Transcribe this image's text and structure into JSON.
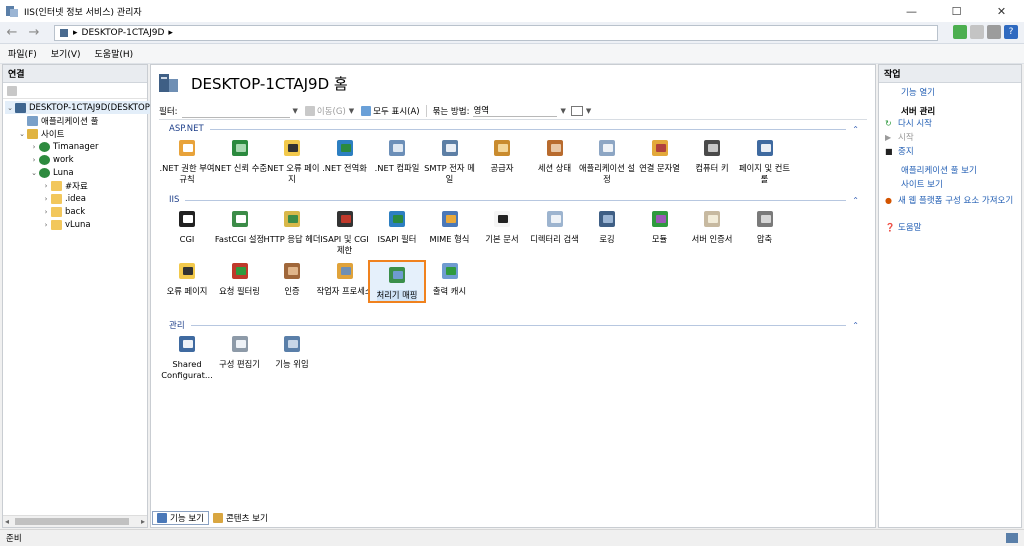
{
  "window": {
    "title": "IIS(인터넷 정보 서비스) 관리자",
    "minimize": "—",
    "maximize": "☐",
    "close": "✕"
  },
  "address": {
    "back": "←",
    "forward": "→",
    "segment": "DESKTOP-1CTAJ9D",
    "sep1": "▸",
    "sep2": "▸",
    "help_label": "?"
  },
  "menu": {
    "items": [
      "파일(F)",
      "보기(V)",
      "도움말(H)"
    ]
  },
  "connections": {
    "header": "연결",
    "tree": [
      {
        "label": "DESKTOP-1CTAJ9D(DESKTOP",
        "exp": "⌄",
        "icon": "server-icon"
      },
      {
        "label": "애플리케이션 풀",
        "exp": "",
        "icon": "app-pool-icon"
      },
      {
        "label": "사이트",
        "exp": "⌄",
        "icon": "sites-icon"
      },
      {
        "label": "Timanager",
        "exp": "›",
        "icon": "globe-icon"
      },
      {
        "label": "work",
        "exp": "›",
        "icon": "globe-icon"
      },
      {
        "label": "Luna",
        "exp": "⌄",
        "icon": "globe-icon"
      },
      {
        "label": "#자료",
        "exp": "›",
        "icon": "folder-icon"
      },
      {
        "label": ".idea",
        "exp": "›",
        "icon": "folder-icon"
      },
      {
        "label": "back",
        "exp": "›",
        "icon": "folder-icon"
      },
      {
        "label": "vLuna",
        "exp": "›",
        "icon": "folder-icon"
      }
    ]
  },
  "home": {
    "title": "DESKTOP-1CTAJ9D 홈",
    "filter_label": "필터:",
    "go_label": "이동(G)",
    "show_all_label": "모두 표시(A)",
    "group_by_label": "묶는 방법:",
    "group_by_value": "영역"
  },
  "groups": {
    "aspnet": "ASP.NET",
    "iis": "IIS",
    "management": "관리",
    "collapse": "⌃"
  },
  "features_aspnet": [
    {
      "label": ".NET 권한 부여 규칙",
      "icon": "authorization-rules-icon"
    },
    {
      "label": ".NET 신뢰 수준",
      "icon": "trust-levels-icon"
    },
    {
      "label": ".NET 오류 페이지",
      "icon": "net-error-pages-icon"
    },
    {
      "label": ".NET 전역화",
      "icon": "globalization-icon"
    },
    {
      "label": ".NET 컴파일",
      "icon": "compilation-icon"
    },
    {
      "label": "SMTP 전자 메일",
      "icon": "smtp-email-icon"
    },
    {
      "label": "공급자",
      "icon": "providers-icon"
    },
    {
      "label": "세션 상태",
      "icon": "session-state-icon"
    },
    {
      "label": "애플리케이션 설정",
      "icon": "app-settings-icon"
    },
    {
      "label": "연결 문자열",
      "icon": "connection-strings-icon"
    },
    {
      "label": "컴퓨터 키",
      "icon": "machine-key-icon"
    },
    {
      "label": "페이지 및 컨트롤",
      "icon": "pages-controls-icon"
    }
  ],
  "features_iis_row1": [
    {
      "label": "CGI",
      "icon": "cgi-icon"
    },
    {
      "label": "FastCGI 설정",
      "icon": "fastcgi-icon"
    },
    {
      "label": "HTTP 응답 헤더",
      "icon": "http-headers-icon"
    },
    {
      "label": "ISAPI 및 CGI 제한",
      "icon": "isapi-cgi-restrictions-icon"
    },
    {
      "label": "ISAPI 필터",
      "icon": "isapi-filters-icon"
    },
    {
      "label": "MIME 형식",
      "icon": "mime-types-icon"
    },
    {
      "label": "기본 문서",
      "icon": "default-document-icon"
    },
    {
      "label": "디렉터리 검색",
      "icon": "directory-browsing-icon"
    },
    {
      "label": "로깅",
      "icon": "logging-icon"
    },
    {
      "label": "모듈",
      "icon": "modules-icon"
    },
    {
      "label": "서버 인증서",
      "icon": "server-certificates-icon"
    },
    {
      "label": "압축",
      "icon": "compression-icon"
    }
  ],
  "features_iis_row2": [
    {
      "label": "오류 페이지",
      "icon": "error-pages-icon"
    },
    {
      "label": "요청 필터링",
      "icon": "request-filtering-icon"
    },
    {
      "label": "인증",
      "icon": "authentication-icon"
    },
    {
      "label": "작업자 프로세스",
      "icon": "worker-processes-icon"
    },
    {
      "label": "처리기 매핑",
      "icon": "handler-mappings-icon"
    },
    {
      "label": "출력 캐시",
      "icon": "output-caching-icon"
    }
  ],
  "features_management": [
    {
      "label": "Shared Configurat...",
      "icon": "shared-configuration-icon"
    },
    {
      "label": "구성 편집기",
      "icon": "configuration-editor-icon"
    },
    {
      "label": "기능 위임",
      "icon": "feature-delegation-icon"
    }
  ],
  "view_tabs": {
    "features": "기능 보기",
    "content": "콘텐츠 보기"
  },
  "actions": {
    "header": "작업",
    "open_feature": "기능 열기",
    "server_manage": "서버 관리",
    "restart": "다시 시작",
    "start": "시작",
    "stop": "중지",
    "view_app_pools": "애플리케이션 풀 보기",
    "view_sites": "사이트 보기",
    "get_new_components": "새 웹 플랫폼 구성 요소 가져오기",
    "help": "도움말"
  },
  "status": {
    "text": "준비"
  },
  "colors": {
    "accent": "#2460b5",
    "selection_border": "#f0821e",
    "group_header": "#1e3f8a"
  }
}
